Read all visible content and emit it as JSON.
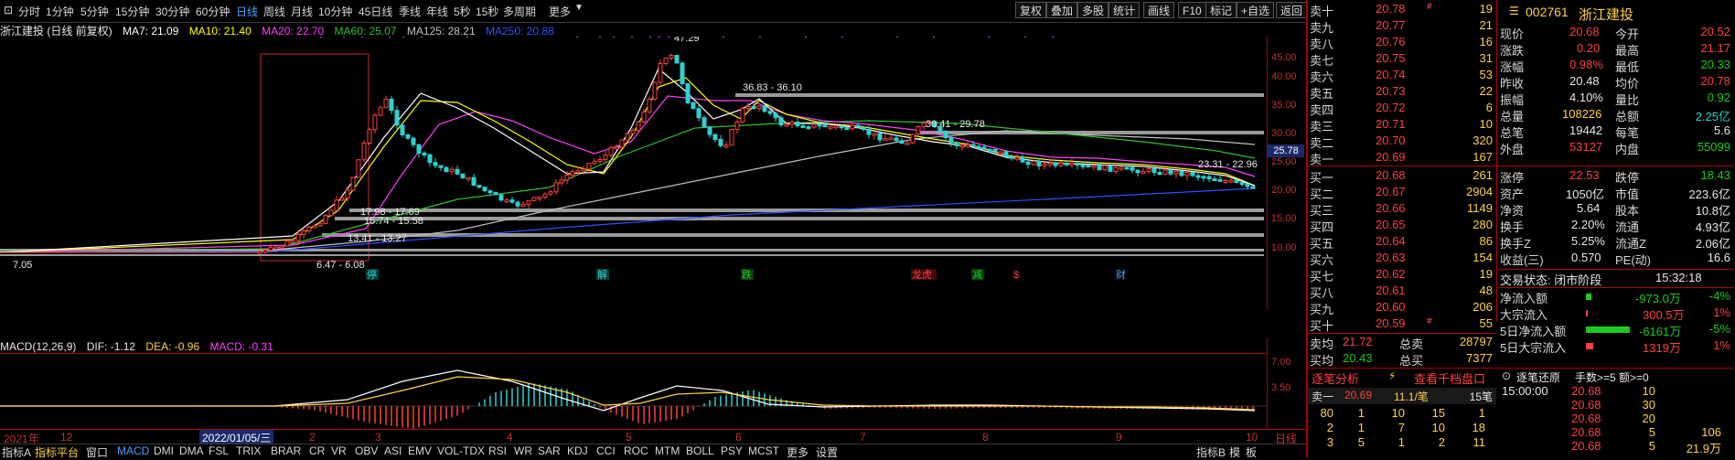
{
  "topbar": {
    "timeframes": [
      "分时",
      "1分钟",
      "5分钟",
      "15分钟",
      "30分钟",
      "60分钟",
      "日线",
      "周线",
      "月线",
      "10分钟",
      "45日线",
      "季线",
      "年线",
      "5秒",
      "15秒",
      "多周期",
      "更多"
    ],
    "active_timeframe": "日线",
    "buttons": [
      "复权",
      "叠加",
      "多股",
      "统计",
      "画线",
      "F10",
      "标记",
      "+自选",
      "返回"
    ]
  },
  "legend": {
    "title": "浙江建投 (日线 前复权)",
    "ma7": "MA7: 21.09",
    "ma10": "MA10: 21.40",
    "ma20": "MA20: 22.70",
    "ma60": "MA60: 25.07",
    "ma125": "MA125: 28.21",
    "ma250": "MA250: 20.88",
    "colors": {
      "ma7": "#ffffff",
      "ma10": "#ffff00",
      "ma20": "#ff40ff",
      "ma60": "#30c030",
      "ma125": "#c0c0c0",
      "ma250": "#3050ff"
    }
  },
  "main_axis": {
    "ticks": [
      "45.00",
      "40.00",
      "35.00",
      "30.00",
      "25.00",
      "20.00",
      "15.00",
      "10.00"
    ],
    "current_price": "25.78"
  },
  "annotations": {
    "peak": "47.29",
    "range1": "36.83 - 36.10",
    "range2": "30.41 - 29.78",
    "range3": "23.31 - 22.96",
    "range4": "17.98 - 17.69",
    "range5": "15.74 - 15.58",
    "range6": "13.41 - 13.27",
    "low1": "7.05",
    "low2": "6.47 - 6.08"
  },
  "event_marks": [
    {
      "text": "停",
      "color": "#30d0d0"
    },
    {
      "text": "解",
      "color": "#30d0d0"
    },
    {
      "text": "跌",
      "color": "#1ecb1e"
    },
    {
      "text": "龙虎",
      "color": "#ff4040"
    },
    {
      "text": "减",
      "color": "#1ecb1e"
    },
    {
      "text": "$",
      "color": "#ff4040"
    },
    {
      "text": "财",
      "color": "#4fa0ff"
    }
  ],
  "macd_legend": {
    "label": "MACD(12,26,9)",
    "dif": "DIF: -1.12",
    "dea": "DEA: -0.96",
    "macd": "MACD: -0.31"
  },
  "macd_axis": {
    "ticks": [
      "7.00",
      "3.50"
    ]
  },
  "date_axis": {
    "labels": [
      "2021年",
      "12",
      "2",
      "3",
      "4",
      "5",
      "6",
      "7",
      "8",
      "9",
      "10"
    ],
    "selected": "2022/01/05/三",
    "right_label": "日线"
  },
  "bottombar": {
    "items": [
      "指标A",
      "指标平台",
      "窗口",
      "MACD",
      "DMI",
      "DMA",
      "FSL",
      "TRIX",
      "BRAR",
      "CR",
      "VR",
      "OBV",
      "ASI",
      "EMV",
      "VOL-TDX",
      "RSI",
      "WR",
      "SAR",
      "KDJ",
      "CCI",
      "ROC",
      "MTM",
      "BOLL",
      "PSY",
      "MCST",
      "更多",
      "设置"
    ],
    "right_items": [
      "指标B",
      "模",
      "板"
    ]
  },
  "stock": {
    "code": "002761",
    "name": "浙江建投"
  },
  "asks": [
    {
      "label": "卖十",
      "price": "20.78",
      "vol": "19",
      "mark": "#"
    },
    {
      "label": "卖九",
      "price": "20.77",
      "vol": "21",
      "mark": ""
    },
    {
      "label": "卖八",
      "price": "20.76",
      "vol": "16",
      "mark": ""
    },
    {
      "label": "卖七",
      "price": "20.75",
      "vol": "31",
      "mark": ""
    },
    {
      "label": "卖六",
      "price": "20.74",
      "vol": "53",
      "mark": ""
    },
    {
      "label": "卖五",
      "price": "20.73",
      "vol": "22",
      "mark": ""
    },
    {
      "label": "卖四",
      "price": "20.72",
      "vol": "6",
      "mark": ""
    },
    {
      "label": "卖三",
      "price": "20.71",
      "vol": "10",
      "mark": ""
    },
    {
      "label": "卖二",
      "price": "20.70",
      "vol": "320",
      "mark": ""
    },
    {
      "label": "卖一",
      "price": "20.69",
      "vol": "167",
      "mark": ""
    }
  ],
  "bids": [
    {
      "label": "买一",
      "price": "20.68",
      "vol": "261",
      "mark": ""
    },
    {
      "label": "买二",
      "price": "20.67",
      "vol": "2904",
      "mark": ""
    },
    {
      "label": "买三",
      "price": "20.66",
      "vol": "1149",
      "mark": ""
    },
    {
      "label": "买四",
      "price": "20.65",
      "vol": "280",
      "mark": ""
    },
    {
      "label": "买五",
      "price": "20.64",
      "vol": "86",
      "mark": ""
    },
    {
      "label": "买六",
      "price": "20.63",
      "vol": "154",
      "mark": ""
    },
    {
      "label": "买七",
      "price": "20.62",
      "vol": "19",
      "mark": ""
    },
    {
      "label": "买八",
      "price": "20.61",
      "vol": "48",
      "mark": ""
    },
    {
      "label": "买九",
      "price": "20.60",
      "vol": "206",
      "mark": ""
    },
    {
      "label": "买十",
      "price": "20.59",
      "vol": "55",
      "mark": "#"
    }
  ],
  "summary": {
    "sell_avg_label": "卖均",
    "sell_avg": "21.72",
    "sell_total_label": "总卖",
    "sell_total": "28797",
    "buy_avg_label": "买均",
    "buy_avg": "20.43",
    "buy_total_label": "总买",
    "buy_total": "7377"
  },
  "quote": [
    {
      "l1": "现价",
      "v1": "20.68",
      "c1": "red",
      "l2": "今开",
      "v2": "20.52",
      "c2": "red"
    },
    {
      "l1": "涨跌",
      "v1": "0.20",
      "c1": "red",
      "l2": "最高",
      "v2": "21.17",
      "c2": "red"
    },
    {
      "l1": "涨幅",
      "v1": "0.98%",
      "c1": "red",
      "l2": "最低",
      "v2": "20.33",
      "c2": "green"
    },
    {
      "l1": "昨收",
      "v1": "20.48",
      "c1": "white",
      "l2": "均价",
      "v2": "20.78",
      "c2": "red"
    },
    {
      "l1": "振幅",
      "v1": "4.10%",
      "c1": "white",
      "l2": "量比",
      "v2": "0.92",
      "c2": "green"
    },
    {
      "l1": "总量",
      "v1": "108226",
      "c1": "yellow",
      "l2": "总额",
      "v2": "2.25亿",
      "c2": "cyan"
    },
    {
      "l1": "总笔",
      "v1": "19442",
      "c1": "white",
      "l2": "每笔",
      "v2": "5.6",
      "c2": "white"
    },
    {
      "l1": "外盘",
      "v1": "53127",
      "c1": "red",
      "l2": "内盘",
      "v2": "55099",
      "c2": "green"
    }
  ],
  "fundamentals": [
    {
      "l1": "涨停",
      "v1": "22.53",
      "c1": "red",
      "l2": "跌停",
      "v2": "18.43",
      "c2": "green"
    },
    {
      "l1": "资产",
      "v1": "1050亿",
      "c1": "white",
      "l2": "市值",
      "v2": "223.6亿",
      "c2": "white"
    },
    {
      "l1": "净资",
      "v1": "5.64",
      "c1": "white",
      "l2": "股本",
      "v2": "10.8亿",
      "c2": "white"
    },
    {
      "l1": "换手",
      "v1": "2.20%",
      "c1": "white",
      "l2": "流通",
      "v2": "4.93亿",
      "c2": "white"
    },
    {
      "l1": "换手Z",
      "v1": "5.25%",
      "c1": "white",
      "l2": "流通Z",
      "v2": "2.06亿",
      "c2": "white"
    },
    {
      "l1": "收益(三)",
      "v1": "0.570",
      "c1": "white",
      "l2": "PE(动)",
      "v2": "16.6",
      "c2": "white"
    }
  ],
  "trade_status": {
    "label": "交易状态: 闭市阶段",
    "time": "15:32:18"
  },
  "flows": [
    {
      "label": "净流入额",
      "value": "-973.0万",
      "pct": "-4%",
      "vc": "green",
      "bar": 0.02
    },
    {
      "label": "大宗流入",
      "value": "300.5万",
      "pct": "1%",
      "vc": "red",
      "bar": 0.01
    },
    {
      "label": "5日净流入额",
      "value": "-6161万",
      "pct": "-5%",
      "vc": "green",
      "bar": 0.8
    },
    {
      "label": "5日大宗流入",
      "value": "1319万",
      "pct": "1%",
      "vc": "red",
      "bar": 0.1
    }
  ],
  "tick_header": {
    "analysis": "逐笔分析",
    "level": "查看千档盘口",
    "restore": "逐笔还原",
    "filter": "手数>=5 额>=0"
  },
  "tick_summary": {
    "label": "卖一",
    "price": "20.69",
    "lots": "11.1/笔",
    "count": "15笔"
  },
  "tick_grid": [
    [
      "80",
      "1",
      "10",
      "15",
      "1"
    ],
    [
      "2",
      "1",
      "7",
      "10",
      "18"
    ],
    [
      "3",
      "5",
      "1",
      "2",
      "11"
    ]
  ],
  "trades": [
    {
      "time": "15:00:00",
      "price": "20.68",
      "vol": "10",
      "extra": ""
    },
    {
      "time": "",
      "price": "20.68",
      "vol": "30",
      "extra": ""
    },
    {
      "time": "",
      "price": "20.68",
      "vol": "20",
      "extra": ""
    },
    {
      "time": "",
      "price": "20.68",
      "vol": "5",
      "extra": "106"
    },
    {
      "time": "",
      "price": "20.68",
      "vol": "5",
      "extra": "21.9万"
    }
  ]
}
